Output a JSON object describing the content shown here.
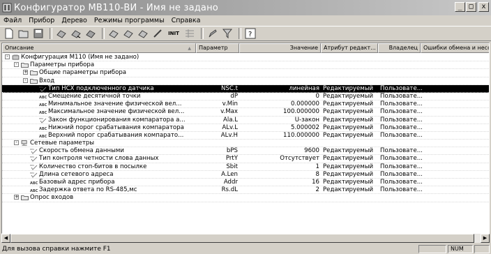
{
  "window": {
    "title": "Конфигуратор МВ110-ВИ - Имя не задано",
    "min_label": "_",
    "max_label": "□",
    "close_label": "x"
  },
  "menu": [
    {
      "label": "Файл",
      "name": "menu-file"
    },
    {
      "label": "Прибор",
      "name": "menu-device"
    },
    {
      "label": "Дерево",
      "name": "menu-tree"
    },
    {
      "label": "Режимы программы",
      "name": "menu-modes"
    },
    {
      "label": "Справка",
      "name": "menu-help"
    }
  ],
  "toolbar": {
    "init_label": "INIT"
  },
  "columns": {
    "description": "Описание",
    "parameter": "Параметр",
    "value": "Значение",
    "attribute": "Атрибут редакт...",
    "owner": "Владелец",
    "errors": "Ошибки обмена и несоот"
  },
  "rows": [
    {
      "type": "root",
      "level": 0,
      "expander": "-",
      "label": "Конфигурация М110 (Имя не задано)"
    },
    {
      "type": "folder",
      "level": 1,
      "expander": "-",
      "label": "Параметры прибора"
    },
    {
      "type": "folder",
      "level": 2,
      "expander": "+",
      "label": "Общие параметры прибора"
    },
    {
      "type": "folder",
      "level": 2,
      "expander": "-",
      "label": "Вход"
    },
    {
      "type": "hex",
      "level": 3,
      "label": "Тип НСХ подключенного датчика",
      "param": "NSC.t",
      "value": "линейная",
      "attr": "Редактируемый",
      "owner": "Пользовате...",
      "selected": true
    },
    {
      "type": "abc",
      "level": 3,
      "label": "Смещение десятичной точки",
      "param": "dP",
      "value": "0",
      "attr": "Редактируемый",
      "owner": "Пользовате..."
    },
    {
      "type": "abc",
      "level": 3,
      "label": "Минимальное значение физической вел...",
      "param": "v.Min",
      "value": "0.000000",
      "attr": "Редактируемый",
      "owner": "Пользовате..."
    },
    {
      "type": "abc",
      "level": 3,
      "label": "Максимальное значение физической вел...",
      "param": "v.Max",
      "value": "100.000000",
      "attr": "Редактируемый",
      "owner": "Пользовате..."
    },
    {
      "type": "hex",
      "level": 3,
      "label": "Закон функционирования компаратора а...",
      "param": "Ala.L",
      "value": "U-закон",
      "attr": "Редактируемый",
      "owner": "Пользовате..."
    },
    {
      "type": "abc",
      "level": 3,
      "label": "Нижний порог срабатывания компаратора",
      "param": "ALv.L",
      "value": "5.000002",
      "attr": "Редактируемый",
      "owner": "Пользовате..."
    },
    {
      "type": "abc",
      "level": 3,
      "label": "Верхний порог срабатывания компарато...",
      "param": "ALv.H",
      "value": "110.000000",
      "attr": "Редактируемый",
      "owner": "Пользовате..."
    },
    {
      "type": "netfolder",
      "level": 1,
      "expander": "-",
      "label": "Сетевые параметры"
    },
    {
      "type": "hex",
      "level": 2,
      "label": "Скорость обмена данными",
      "param": "bPS",
      "value": "9600",
      "attr": "Редактируемый",
      "owner": "Пользовате..."
    },
    {
      "type": "hex",
      "level": 2,
      "label": "Тип контроля четности слова данных",
      "param": "PrtY",
      "value": "Отсутствует",
      "attr": "Редактируемый",
      "owner": "Пользовате..."
    },
    {
      "type": "hex",
      "level": 2,
      "label": "Количество стоп-битов в посылке",
      "param": "Sbit",
      "value": "1",
      "attr": "Редактируемый",
      "owner": "Пользовате..."
    },
    {
      "type": "hex",
      "level": 2,
      "label": "Длина сетевого адреса",
      "param": "A.Len",
      "value": "8",
      "attr": "Редактируемый",
      "owner": "Пользовате..."
    },
    {
      "type": "abc",
      "level": 2,
      "label": "Базовый адрес прибора",
      "param": "Addr",
      "value": "16",
      "attr": "Редактируемый",
      "owner": "Пользовате..."
    },
    {
      "type": "abc",
      "level": 2,
      "label": "Задержка ответа по RS-485,мс",
      "param": "Rs.dL",
      "value": "2",
      "attr": "Редактируемый",
      "owner": "Пользовате..."
    },
    {
      "type": "folder",
      "level": 1,
      "expander": "+",
      "label": "Опрос входов"
    }
  ],
  "status": {
    "text": "Для вызова справки нажмите F1",
    "num": "NUM"
  },
  "colors": {
    "selection": "#000000",
    "window_bg": "#d4d0c8"
  }
}
